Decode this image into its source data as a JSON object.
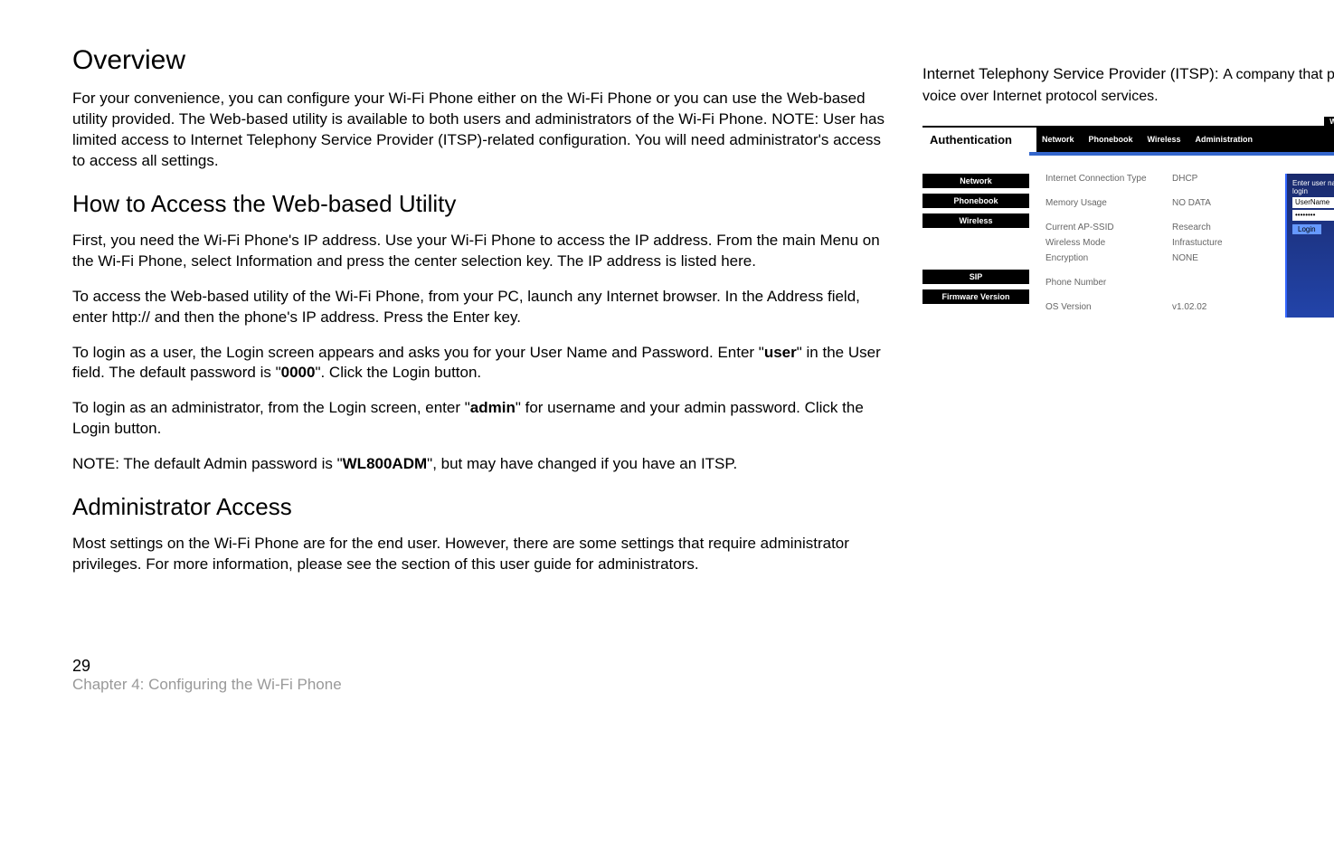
{
  "headings": {
    "overview": "Overview",
    "howto": "How to Access the Web-based Utility",
    "adminaccess": "Administrator Access"
  },
  "paragraphs": {
    "overview_p1": "For your convenience, you can configure your Wi-Fi Phone either on the Wi-Fi Phone or you can use the Web-based utility provided. The Web-based utility is available to both users and administrators of the Wi-Fi Phone. NOTE: User has limited access to Internet Telephony Service Provider (ITSP)-related configuration. You will need administrator's access to access all settings.",
    "howto_p1": "First, you need the Wi-Fi Phone's IP address. Use your Wi-Fi Phone to access the IP address. From the main Menu on the Wi-Fi Phone, select Information and press the center selection key. The IP address is listed here.",
    "howto_p2": "To access the Web-based utility of the Wi-Fi Phone, from your PC, launch any Internet browser. In the Address field, enter http:// and then the phone's IP address. Press the Enter key.",
    "howto_p3_a": "To login as a user, the Login screen appears and asks you for your User Name and Password. Enter \"",
    "howto_p3_b": "user",
    "howto_p3_c": "\" in the User field. The default password is \"",
    "howto_p3_d": "0000",
    "howto_p3_e": "\". Click the Login button.",
    "howto_p4_a": "To login as an administrator, from the Login screen, enter \"",
    "howto_p4_b": "admin",
    "howto_p4_c": "\" for username and your admin password. Click the Login button.",
    "howto_p5_a": "NOTE: The default Admin password is \"",
    "howto_p5_b": "WL800ADM",
    "howto_p5_c": "\", but may have changed if you have an ITSP.",
    "admin_p1": "Most settings on the Wi-Fi Phone are for the end user. However, there are some settings that require administrator privileges. For more information, please see the section of this user guide for administrators."
  },
  "glossary": {
    "term": "Internet Telephony Service Provider (ITSP): ",
    "def": "A company that provides voice over Internet protocol services."
  },
  "screenshot": {
    "title_badge": "Wireless VoIP\nPhone",
    "auth_label": "Authentication",
    "tabs": [
      "Network",
      "Phonebook",
      "Wireless",
      "Administration"
    ],
    "sidebar": [
      "Network",
      "Phonebook",
      "Wireless",
      "SIP",
      "Firmware Version"
    ],
    "rows": [
      {
        "label": "Internet Connection Type",
        "value": "DHCP"
      },
      {
        "label": "Memory Usage",
        "value": "NO DATA"
      },
      {
        "label": "Current AP-SSID",
        "value": "Research"
      },
      {
        "label": "Wireless Mode",
        "value": "Infrastucture"
      },
      {
        "label": "Encryption",
        "value": "NONE"
      },
      {
        "label": "Phone Number",
        "value": ""
      },
      {
        "label": "OS Version",
        "value": "v1.02.02"
      }
    ],
    "login": {
      "prompt": "Enter user name & password to login",
      "username": "UserName",
      "password": "••••••••",
      "button": "Login"
    }
  },
  "footer": {
    "pagenum": "29",
    "chapter": "Chapter 4: Configuring the Wi-Fi Phone"
  }
}
